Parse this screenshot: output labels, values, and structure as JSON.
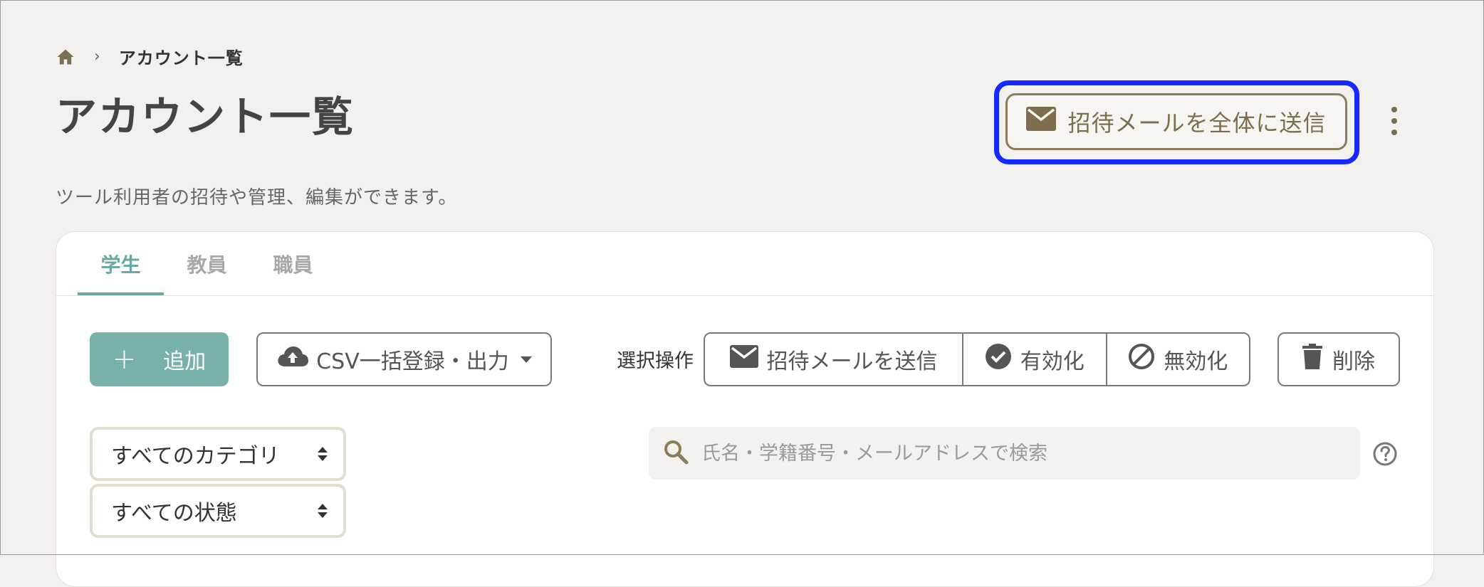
{
  "breadcrumb": {
    "home_icon": "home-icon",
    "separator": "›",
    "current": "アカウント一覧"
  },
  "page": {
    "title": "アカウント一覧",
    "description": "ツール利用者の招待や管理、編集ができます。"
  },
  "header_actions": {
    "send_all_label": "招待メールを全体に送信",
    "send_all_icon": "mail-icon",
    "more_icon": "kebab-icon"
  },
  "tabs": [
    {
      "label": "学生",
      "active": true
    },
    {
      "label": "教員",
      "active": false
    },
    {
      "label": "職員",
      "active": false
    }
  ],
  "toolbar": {
    "add_label": "追加",
    "add_icon": "plus-icon",
    "csv_label": "CSV一括登録・出力",
    "csv_icon": "cloud-upload-icon",
    "selection_label": "選択操作",
    "invite_label": "招待メールを送信",
    "enable_label": "有効化",
    "disable_label": "無効化",
    "delete_label": "削除"
  },
  "filters": {
    "category_value": "すべてのカテゴリ",
    "status_value": "すべての状態"
  },
  "search": {
    "placeholder": "氏名・学籍番号・メールアドレスで検索",
    "value": ""
  },
  "colors": {
    "accent_teal": "#78b0aa",
    "active_tab": "#6ba8a3",
    "brand_gold": "#8c7d5a",
    "highlight_blue": "#1428ff",
    "background": "#f3f1ee"
  }
}
